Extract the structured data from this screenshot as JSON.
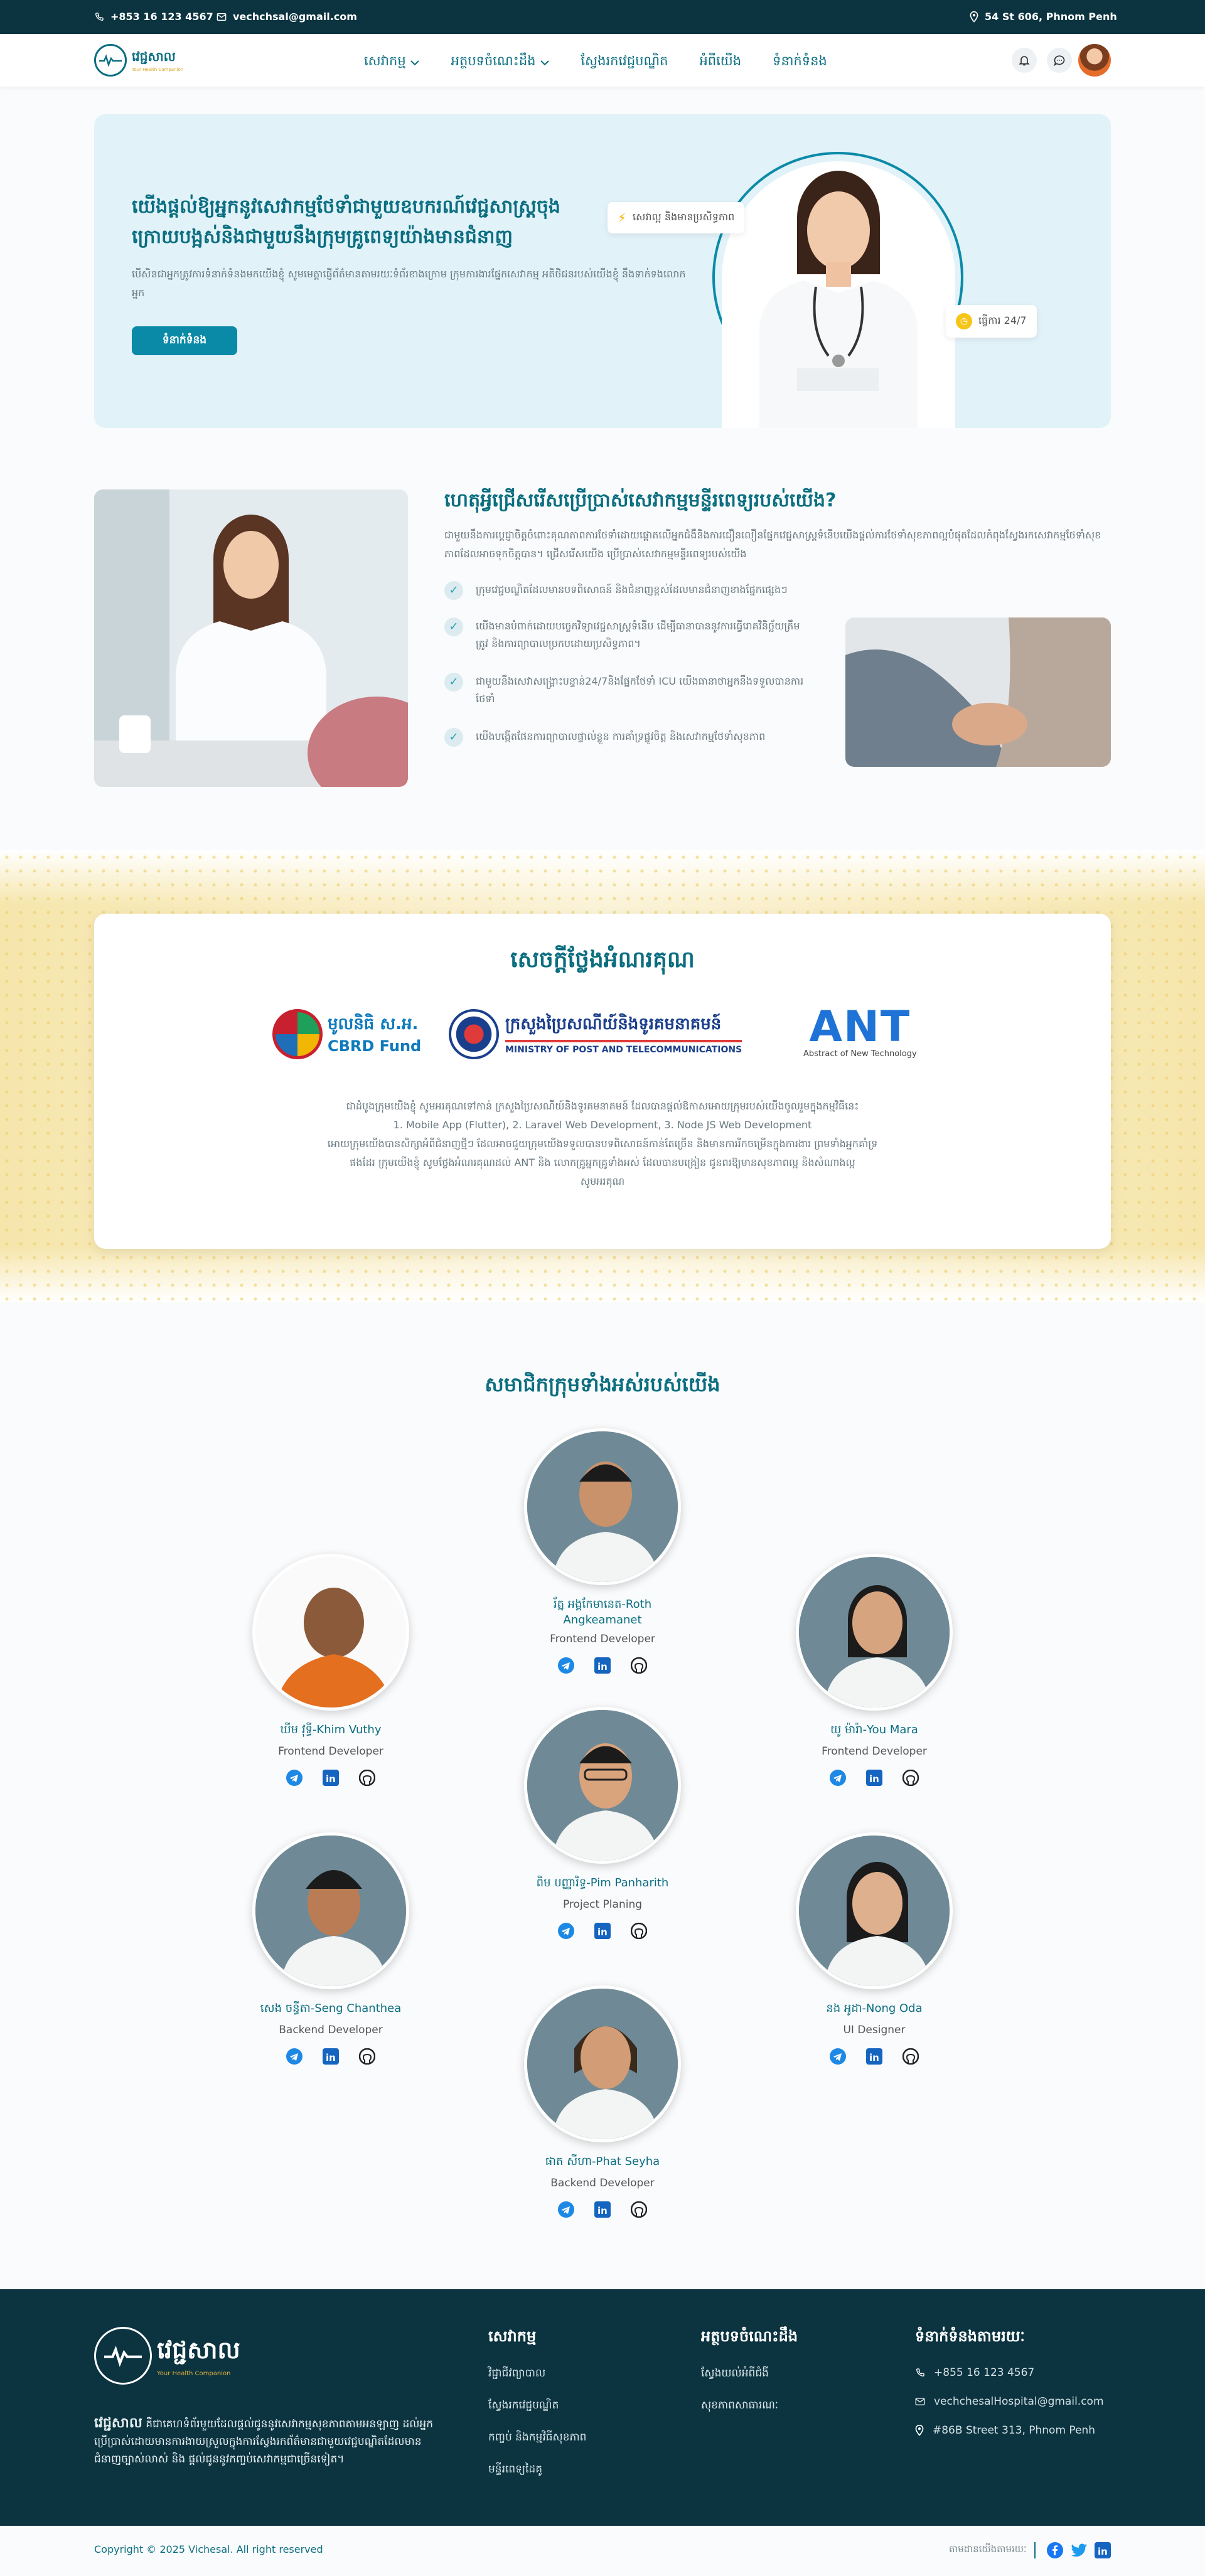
{
  "topbar": {
    "phone": "+853 16 123 4567",
    "email": "vechchsal@gmail.com",
    "address": "54 St 606, Phnom Penh"
  },
  "brand": {
    "name": "វេជ្ជសាល",
    "tagline": "Your Health Companion",
    "footer_tagline": "Your Health Companion"
  },
  "nav": {
    "items": [
      "សេវាកម្ម",
      "អត្ថបទចំណេះដឹង",
      "ស្វែងរកវេជ្ជបណ្ឌិត",
      "អំពីយើង",
      "ទំនាក់ទំនង"
    ]
  },
  "hero": {
    "title": "យើងផ្តល់ឱ្យអ្នកនូវសេវាកម្មថែទាំជាមួយឧបករណ៍វេជ្ជសាស្រ្តចុងក្រោយបង្អស់និងជាមួយនឹងក្រុមគ្រូពេទ្យយ៉ាងមានជំនាញ",
    "subtitle": "បើសិនជាអ្នកត្រូវការទំនាក់ទំនងមកយើងខ្ញុំ សូមមេត្តាផ្ញើព័ត៌មានតាមរយៈទំព័រខាងក្រោម ក្រុមការងារផ្នែកសេវាកម្ម អតិថិជនរបស់យើងខ្ញុំ នឹងទាក់ទងលោកអ្នក",
    "button": "ទំនាក់ទំនង",
    "chip1": "សេវាល្អ និងមានប្រសិទ្ធភាព",
    "chip2": "ធ្វើការ 24/7"
  },
  "why": {
    "title": "ហេតុអ្វីជ្រើសរើសប្រើប្រាស់សេវាកម្មមន្ទីរពេទ្យរបស់យើង?",
    "intro": "ជាមួយនឹងការប្តេជ្ញាចិត្តចំពោះគុណភាពការថែទាំដោយផ្តោតលើអ្នកជំងឺនិងការជឿនលឿនផ្នែកវេជ្ជសាស្រ្តទំនើបយើងផ្តល់ការថែទាំសុខភាពល្អបំផុតដែលកំពុងស្វែងរកសេវាកម្មថែទាំសុខភាពដែលអាចទុកចិត្តបាន។ ជ្រើសរើសយើង ប្រើប្រាស់សេវាកម្មមន្ទីរពេទ្យរបស់យើង",
    "points": [
      "ក្រុមវេជ្ជបណ្ឌិតដែលមានបទពិសោធន៍ និងជំនាញខ្ពស់ដែលមានជំនាញខាងផ្នែកផ្សេងៗ",
      "យើងមានបំពាក់ដោយបច្ចេកវិទ្យាវេជ្ជសាស្រ្តទំនើប ដើម្បីធានាបាននូវការធ្វើរោគវិនិច្ឆ័យត្រឹមត្រូវ និងការព្យាបាលប្រកបដោយប្រសិទ្ធភាព។",
      "ជាមួយនឹងសេវាសង្គ្រោះបន្ទាន់24/7និងផ្នែកថែទាំ ICU យើងធានាថាអ្នកនឹងទទួលបានការថែទាំ",
      "យើងបង្កើតផែនការព្យាបាលផ្ទាល់ខ្លួន ការគាំទ្រផ្លូវចិត្ត និងសេវាកម្មថែទាំសុខភាព"
    ]
  },
  "award": {
    "title": "សេចក្តីថ្លែងអំណរគុណ",
    "logos": [
      "មូលនិធិ ស.អ.",
      "CBRD Fund",
      "ក្រសួងប្រៃសណីយ៍និងទូរគមនាគមន៍",
      "MINISTRY OF POST AND TELECOMMUNICATIONS",
      "ANT",
      "Abstract of New Technology"
    ],
    "line1": "ជាដំបូងក្រុមយើងខ្ញុំ សូមអរគុណទៅកាន់ ក្រសួងប្រៃសណីយ៍និងទូរគមនាគមន៍ ដែលបានផ្តល់ឱកាសអោយក្រុមរបស់យើងចូលរួមក្នុងកម្មវិធីនេះ",
    "line2": "1. Mobile App (Flutter), 2. Laravel Web Development, 3. Node JS Web Development",
    "line3": "អោយក្រុមយើងបានសិក្សាអំពីជំនាញថ្មីៗ ដែលអាចជួយក្រុមយើងទទួលបានបទពិសោធន៍កាន់តែច្រើន និងមានការរីកចម្រើនក្នុងការងារ ព្រមទាំងអ្នកគាំទ្រ",
    "line4": "ផងដែរ ក្រុមយើងខ្ញុំ សូមថ្លែងអំណរគុណដល់ ANT និង លោកគ្រូអ្នកគ្រូទាំងអស់ ដែលបានបង្រៀន ជូនពរឱ្យមានសុខភាពល្អ និងសំណាងល្អ",
    "line5": "សូមអរគុណ"
  },
  "team": {
    "title": "សមាជិកក្រុមទាំងអស់របស់យើង",
    "members": [
      {
        "name": "រ័ត្ន អង្គកែមានេត-Roth Angkeamanet",
        "role": "Frontend Developer"
      },
      {
        "name": "ឃីម វុទ្ធី-Khim Vuthy",
        "role": "Frontend Developer"
      },
      {
        "name": "យូ ម៉ារ៉ា-You Mara",
        "role": "Frontend Developer"
      },
      {
        "name": "ពិម បញ្ញារិទ្ធ-Pim Panharith",
        "role": "Project Planing"
      },
      {
        "name": "សេង ចន្ធីតា-Seng Chanthea",
        "role": "Backend Developer"
      },
      {
        "name": "នង អូដា-Nong Oda",
        "role": "UI Designer"
      },
      {
        "name": "ផាត សីហា-Phat Seyha",
        "role": "Backend Developer"
      }
    ]
  },
  "footer": {
    "about_bold": "វេជ្ជសាល",
    "about": "គឺជាគេហទំព័រមួយដែលផ្តល់ជូននូវសេវាកម្មសុខភាពតាមអនឡាញ ដល់អ្នកប្រើប្រាស់ដោយមានការងាយស្រួលក្នុងការស្វែងរកព័ត៌មានជាមួយវេជ្ជបណ្ឌិតដែលមានជំនាញច្បាស់លាស់ និង ផ្តល់ជូននូវកញ្ចប់សេវាកម្មជាច្រើនទៀត។",
    "col1_title": "សេវាកម្ម",
    "col1": [
      "វិជ្ជាជីវព្យាបាល",
      "ស្វែងរកវេជ្ជបណ្ឌិត",
      "កញ្ចប់ និងកម្មវិធីសុខភាព",
      "មន្ទីរពេទ្យដៃគូ"
    ],
    "col2_title": "អត្ថបទចំណេះដឹង",
    "col2": [
      "ស្វែងយល់អំពីជំងឺ",
      "សុខភាពសាធារណៈ"
    ],
    "col3_title": "ទំនាក់ទំនងតាមរយៈ",
    "phone": "+855 16 123 4567",
    "email": "vechchesalHospital@gmail.com",
    "address": "#86B Street 313, Phnom Penh",
    "copyright": "Copyright © 2025 Vichesal. All right reserved",
    "follow": "តាមដានយើងតាមរយៈ"
  },
  "colors": {
    "primary": "#0b6e80",
    "dark": "#0b3340",
    "accent": "#0b8aa8",
    "hero_bg": "#e1f2f8"
  }
}
